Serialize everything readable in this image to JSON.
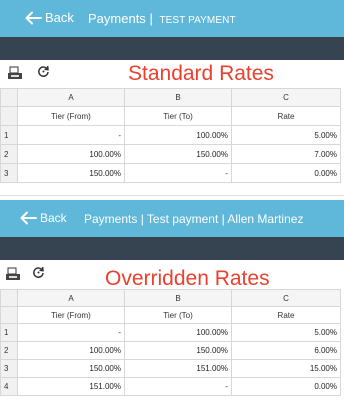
{
  "screen1": {
    "back_label": "Back",
    "title_main": "Payments",
    "title_sep": "|",
    "title_sub": "TEST PAYMENT",
    "heading": "Standard Rates",
    "columns": [
      "A",
      "B",
      "C"
    ],
    "subheaders": [
      "Tier (From)",
      "Tier (To)",
      "Rate"
    ],
    "rows": [
      {
        "num": "1",
        "from": "-",
        "to": "100.00%",
        "rate": "5.00%"
      },
      {
        "num": "2",
        "from": "100.00%",
        "to": "150.00%",
        "rate": "7.00%"
      },
      {
        "num": "3",
        "from": "150.00%",
        "to": "-",
        "rate": "0.00%"
      }
    ]
  },
  "screen2": {
    "back_label": "Back",
    "title": "Payments | Test payment | Allen Martinez",
    "heading": "Overridden Rates",
    "columns": [
      "A",
      "B",
      "C"
    ],
    "subheaders": [
      "Tier (From)",
      "Tier (To)",
      "Rate"
    ],
    "rows": [
      {
        "num": "1",
        "from": "-",
        "to": "100.00%",
        "rate": "5.00%"
      },
      {
        "num": "2",
        "from": "100.00%",
        "to": "150.00%",
        "rate": "6.00%"
      },
      {
        "num": "3",
        "from": "150.00%",
        "to": "151.00%",
        "rate": "15.00%"
      },
      {
        "num": "4",
        "from": "151.00%",
        "to": "-",
        "rate": "0.00%"
      }
    ]
  },
  "colors": {
    "header": "#5fb8d9",
    "dark_bar": "#364350",
    "heading_red": "#e8412f"
  },
  "icons": [
    "back-arrow-icon",
    "save-icon",
    "refresh-icon"
  ]
}
